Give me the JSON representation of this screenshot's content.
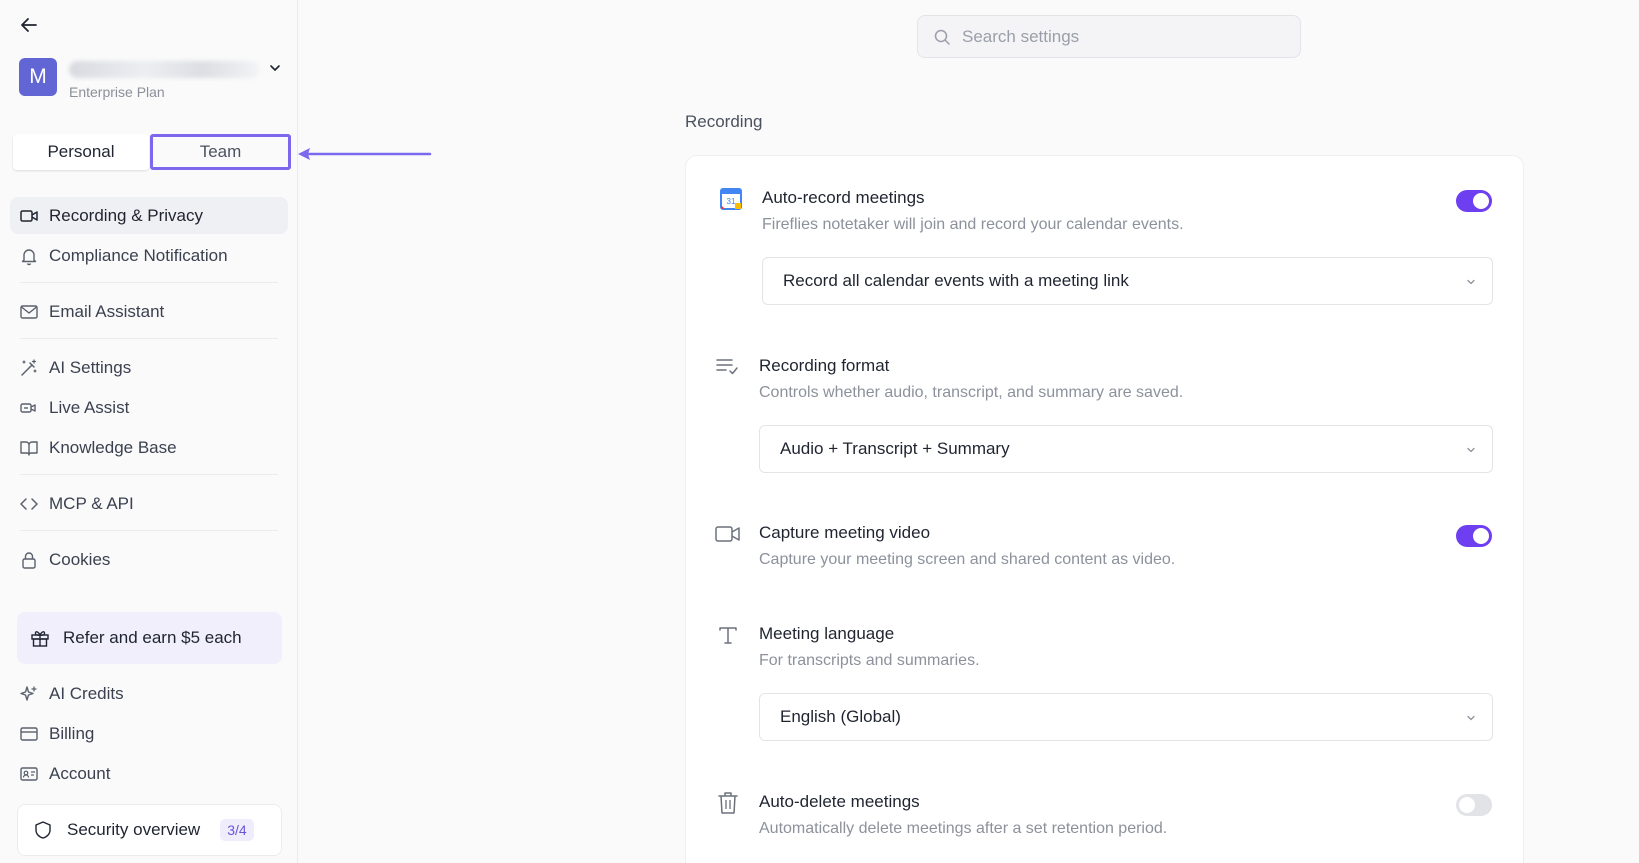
{
  "account": {
    "avatar_letter": "M",
    "plan": "Enterprise Plan"
  },
  "mode_switch": {
    "personal": "Personal",
    "team": "Team"
  },
  "nav": {
    "group1": [
      {
        "label": "Recording & Privacy",
        "icon": "video-camera-icon",
        "active": true
      },
      {
        "label": "Compliance Notification",
        "icon": "bell-icon"
      }
    ],
    "group2": [
      {
        "label": "Email Assistant",
        "icon": "mail-icon"
      }
    ],
    "group3": [
      {
        "label": "AI Settings",
        "icon": "magic-wand-icon"
      },
      {
        "label": "Live Assist",
        "icon": "live-assist-icon"
      },
      {
        "label": "Knowledge Base",
        "icon": "book-icon"
      }
    ],
    "group4": [
      {
        "label": "MCP & API",
        "icon": "code-icon"
      }
    ],
    "group5": [
      {
        "label": "Cookies",
        "icon": "lock-icon"
      }
    ],
    "refer": "Refer and earn $5 each",
    "bottom": [
      {
        "label": "AI Credits",
        "icon": "sparkle-icon"
      },
      {
        "label": "Billing",
        "icon": "credit-card-icon"
      },
      {
        "label": "Account",
        "icon": "id-card-icon"
      }
    ],
    "security": {
      "label": "Security overview",
      "badge": "3/4"
    }
  },
  "search": {
    "placeholder": "Search settings"
  },
  "section": {
    "title": "Recording"
  },
  "settings": {
    "auto_record": {
      "title": "Auto-record meetings",
      "desc": "Fireflies notetaker will join and record your calendar events.",
      "select": "Record all calendar events with a meeting link",
      "enabled": true,
      "icon_text": "31"
    },
    "format": {
      "title": "Recording format",
      "desc": "Controls whether audio, transcript, and summary are saved.",
      "select": "Audio + Transcript + Summary"
    },
    "video": {
      "title": "Capture meeting video",
      "desc": "Capture your meeting screen and shared content as video.",
      "enabled": true
    },
    "language": {
      "title": "Meeting language",
      "desc": "For transcripts and summaries.",
      "select": "English (Global)"
    },
    "auto_delete": {
      "title": "Auto-delete meetings",
      "desc": "Automatically delete meetings after a set retention period.",
      "enabled": false
    }
  },
  "colors": {
    "accent": "#6d3ff0",
    "avatar": "#6166d4",
    "highlight": "#7b68ee"
  }
}
